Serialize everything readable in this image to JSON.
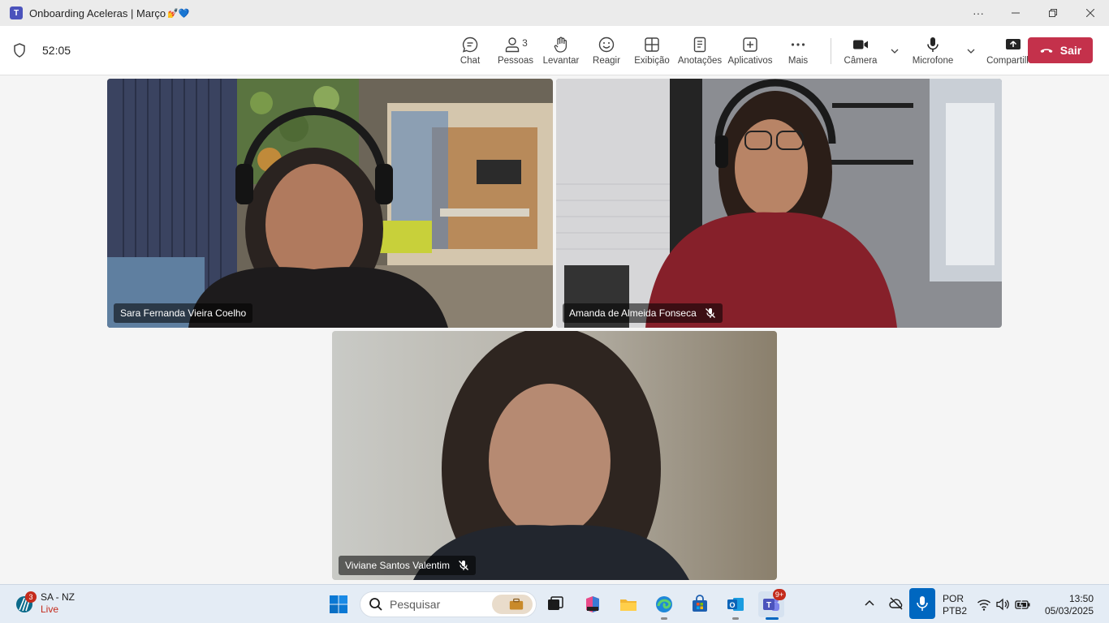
{
  "window": {
    "title": "Onboarding Aceleras | Março",
    "title_emoji": "💅💙",
    "app_icon": "teams-icon"
  },
  "toolbar": {
    "elapsed": "52:05",
    "chat": "Chat",
    "people": "Pessoas",
    "people_count": "3",
    "raise": "Levantar",
    "react": "Reagir",
    "view": "Exibição",
    "notes": "Anotações",
    "apps": "Aplicativos",
    "more": "Mais",
    "camera": "Câmera",
    "mic": "Microfone",
    "share": "Compartilhar",
    "leave": "Sair"
  },
  "participants": [
    {
      "name": "Sara Fernanda Vieira Coelho",
      "muted": false
    },
    {
      "name": "Amanda de Almeida Fonseca",
      "muted": true
    },
    {
      "name": "Viviane Santos Valentim",
      "muted": true
    }
  ],
  "taskbar": {
    "weather_name": "SA - NZ",
    "weather_status": "Live",
    "weather_badge": "3",
    "search_placeholder": "Pesquisar",
    "teams_badge": "9+",
    "lang_1": "POR",
    "lang_2": "PTB2",
    "time": "13:50",
    "date": "05/03/2025"
  },
  "colors": {
    "leave_red": "#c4314b",
    "accent_blue": "#0067c0",
    "teams_purple": "#4b53bc"
  }
}
